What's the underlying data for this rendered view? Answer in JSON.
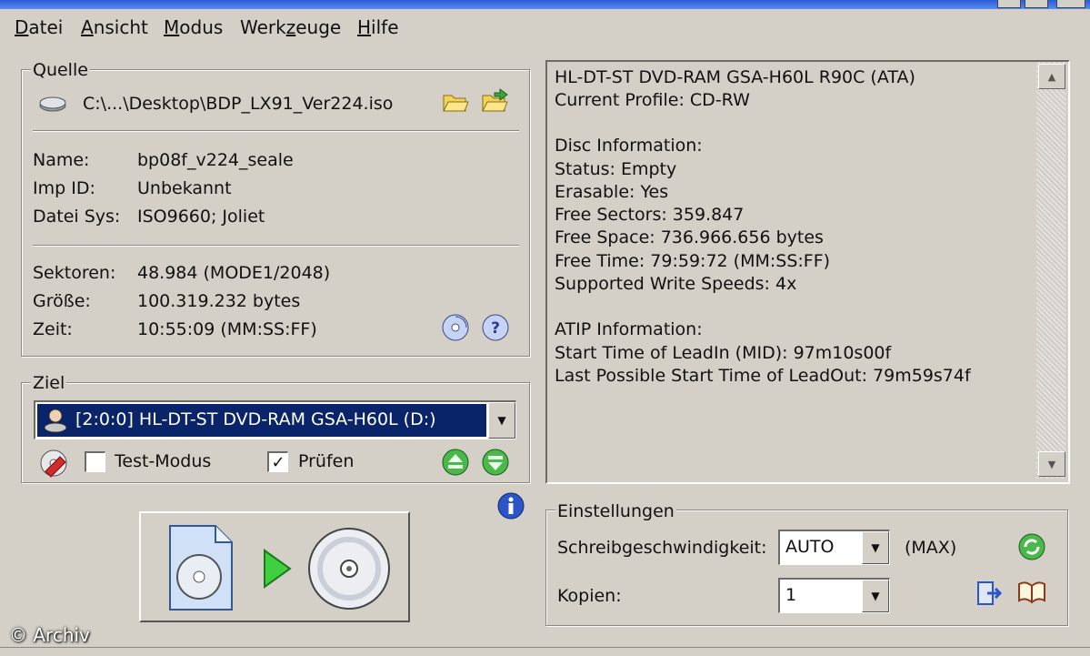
{
  "menu": {
    "datei": {
      "acc": "D",
      "rest": "atei"
    },
    "ansicht": {
      "acc": "A",
      "rest": "nsicht"
    },
    "modus": {
      "acc": "M",
      "rest": "odus"
    },
    "werkzeuge": {
      "pre": "Werk",
      "acc": "z",
      "rest": "euge"
    },
    "hilfe": {
      "acc": "H",
      "rest": "ilfe"
    }
  },
  "source": {
    "legend": "Quelle",
    "path": "C:\\...\\Desktop\\BDP_LX91_Ver224.iso",
    "name_label": "Name:",
    "name_value": "bp08f_v224_seale",
    "impid_label": "Imp ID:",
    "impid_value": "Unbekannt",
    "filesys_label": "Datei Sys:",
    "filesys_value": "ISO9660; Joliet",
    "sectors_label": "Sektoren:",
    "sectors_value": "48.984 (MODE1/2048)",
    "size_label": "Größe:",
    "size_value": "100.319.232 bytes",
    "time_label": "Zeit:",
    "time_value": "10:55:09 (MM:SS:FF)"
  },
  "target": {
    "legend": "Ziel",
    "drive": "[2:0:0] HL-DT-ST DVD-RAM GSA-H60L (D:)",
    "test_mode_label": "Test-Modus",
    "test_mode_checked": false,
    "verify_label": "Prüfen",
    "verify_checked": true
  },
  "info_panel": {
    "lines": [
      "HL-DT-ST DVD-RAM GSA-H60L R90C (ATA)",
      "Current Profile: CD-RW",
      "",
      "Disc Information:",
      "Status: Empty",
      "Erasable: Yes",
      "Free Sectors: 359.847",
      "Free Space: 736.966.656 bytes",
      "Free Time: 79:59:72 (MM:SS:FF)",
      "Supported Write Speeds: 4x",
      "",
      "ATIP Information:",
      "Start Time of LeadIn (MID): 97m10s00f",
      "Last Possible Start Time of LeadOut: 79m59s74f"
    ]
  },
  "settings": {
    "legend": "Einstellungen",
    "speed_label": "Schreibgeschwindigkeit:",
    "speed_value": "AUTO",
    "speed_max": "(MAX)",
    "copies_label": "Kopien:",
    "copies_value": "1"
  },
  "watermark": "© Archiv",
  "colors": {
    "window_bg": "#d4d0c8",
    "selection": "#0a246a",
    "title_bar": "#2a5bd8"
  }
}
